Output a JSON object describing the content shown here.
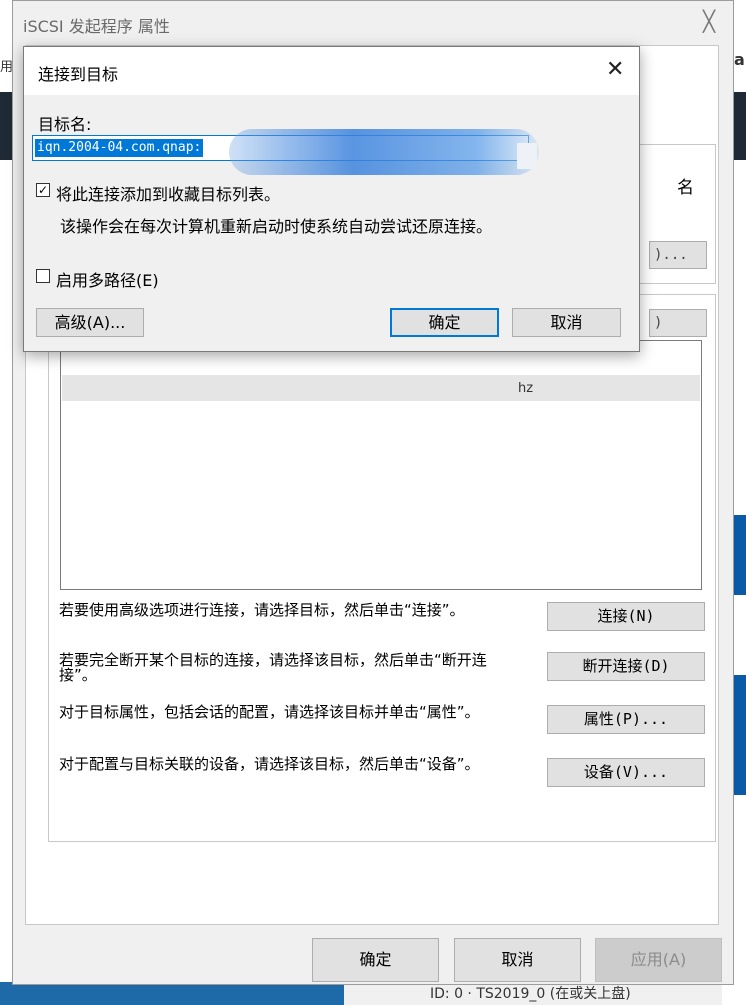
{
  "window": {
    "title": "iSCSI 发起程序 属性",
    "close_glyph": "╳"
  },
  "background": {
    "left_fragment": "用",
    "right_fragment_top": "a",
    "partial_name_label": "名",
    "partial_btn_top": ")...",
    "partial_btn_mid": ")",
    "bottom_text": "ID: 0 · TS2019_0 (在或关上盘)"
  },
  "list": {
    "partial_text": "hz"
  },
  "actions": [
    {
      "description": "若要使用高级选项进行连接，请选择目标，然后单击“连接”。",
      "button": "连接(N)"
    },
    {
      "description": "若要完全断开某个目标的连接，请选择该目标，然后单击“断开连接”。",
      "button": "断开连接(D)"
    },
    {
      "description": "对于目标属性，包括会话的配置，请选择该目标并单击“属性”。",
      "button": "属性(P)..."
    },
    {
      "description": "对于配置与目标关联的设备，请选择该目标，然后单击“设备”。",
      "button": "设备(V)..."
    }
  ],
  "footer": {
    "ok": "确定",
    "cancel": "取消",
    "apply": "应用(A)"
  },
  "dialog": {
    "title": "连接到目标",
    "close_glyph": "✕",
    "target_name_label": "目标名:",
    "target_name_value": "iqn.2004-04.com.qnap:",
    "favorite_checkbox_label": "将此连接添加到收藏目标列表。",
    "favorite_checked": true,
    "favorite_note": "该操作会在每次计算机重新启动时使系统自动尝试还原连接。",
    "multipath_label": "启用多路径(E)",
    "multipath_checked": false,
    "advanced_button": "高级(A)...",
    "ok_button": "确定",
    "cancel_button": "取消"
  }
}
